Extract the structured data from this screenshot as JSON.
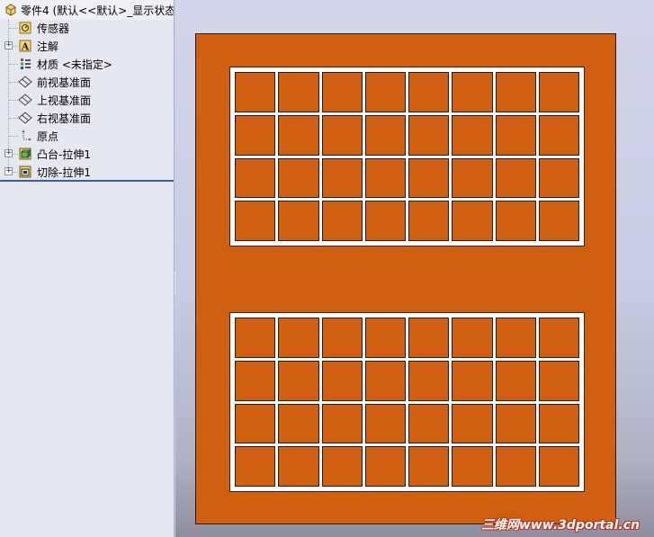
{
  "tree": {
    "header": "零件4  (默认<<默认>_显示状态",
    "items": [
      {
        "label": "传感器",
        "icon": "sensor-icon",
        "expandable": false
      },
      {
        "label": "注解",
        "icon": "annotation-icon",
        "expandable": true
      },
      {
        "label": "材质 <未指定>",
        "icon": "material-icon",
        "expandable": false
      },
      {
        "label": "前视基准面",
        "icon": "plane-icon",
        "expandable": false
      },
      {
        "label": "上视基准面",
        "icon": "plane-icon",
        "expandable": false
      },
      {
        "label": "右视基准面",
        "icon": "plane-icon",
        "expandable": false
      },
      {
        "label": "原点",
        "icon": "origin-icon",
        "expandable": false
      },
      {
        "label": "凸台-拉伸1",
        "icon": "boss-extrude-icon",
        "expandable": true
      },
      {
        "label": "切除-拉伸1",
        "icon": "cut-extrude-icon",
        "expandable": true
      }
    ]
  },
  "model": {
    "plate_color": "#d0600f",
    "grid_rows": 4,
    "grid_cols": 8,
    "grid_count": 2
  },
  "watermark": "三维网www.3dportal.cn"
}
